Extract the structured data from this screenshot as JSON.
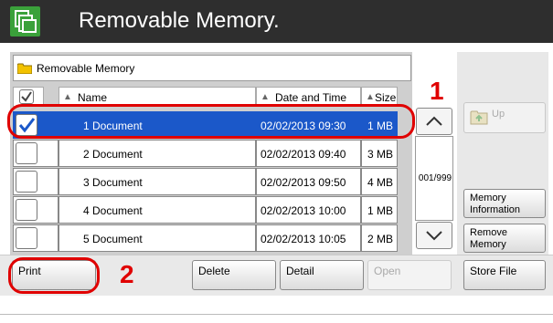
{
  "header": {
    "title": "Removable Memory."
  },
  "path": {
    "label": "Removable Memory"
  },
  "columns": {
    "name": "Name",
    "date": "Date and Time",
    "size": "Size"
  },
  "rows": [
    {
      "name": "1 Document",
      "date": "02/02/2013 09:30",
      "size": "1 MB",
      "checked": true,
      "selected": true
    },
    {
      "name": "2 Document",
      "date": "02/02/2013 09:40",
      "size": "3 MB",
      "checked": false,
      "selected": false
    },
    {
      "name": "3 Document",
      "date": "02/02/2013 09:50",
      "size": "4 MB",
      "checked": false,
      "selected": false
    },
    {
      "name": "4 Document",
      "date": "02/02/2013 10:00",
      "size": "1 MB",
      "checked": false,
      "selected": false
    },
    {
      "name": "5 Document",
      "date": "02/02/2013 10:05",
      "size": "2 MB",
      "checked": false,
      "selected": false
    }
  ],
  "scroll": {
    "page_counter": "001/999"
  },
  "side": {
    "up": "Up",
    "memory_info": "Memory Information",
    "remove": "Remove Memory"
  },
  "toolbar": {
    "print": "Print",
    "delete": "Delete",
    "detail": "Detail",
    "open": "Open",
    "store_file": "Store File"
  },
  "annotations": {
    "marker1": "1",
    "marker2": "2"
  },
  "colors": {
    "selection": "#1b58c9",
    "header_bg": "#2e2e2e",
    "app_icon": "#3aa13a",
    "annotation": "#e00000"
  }
}
